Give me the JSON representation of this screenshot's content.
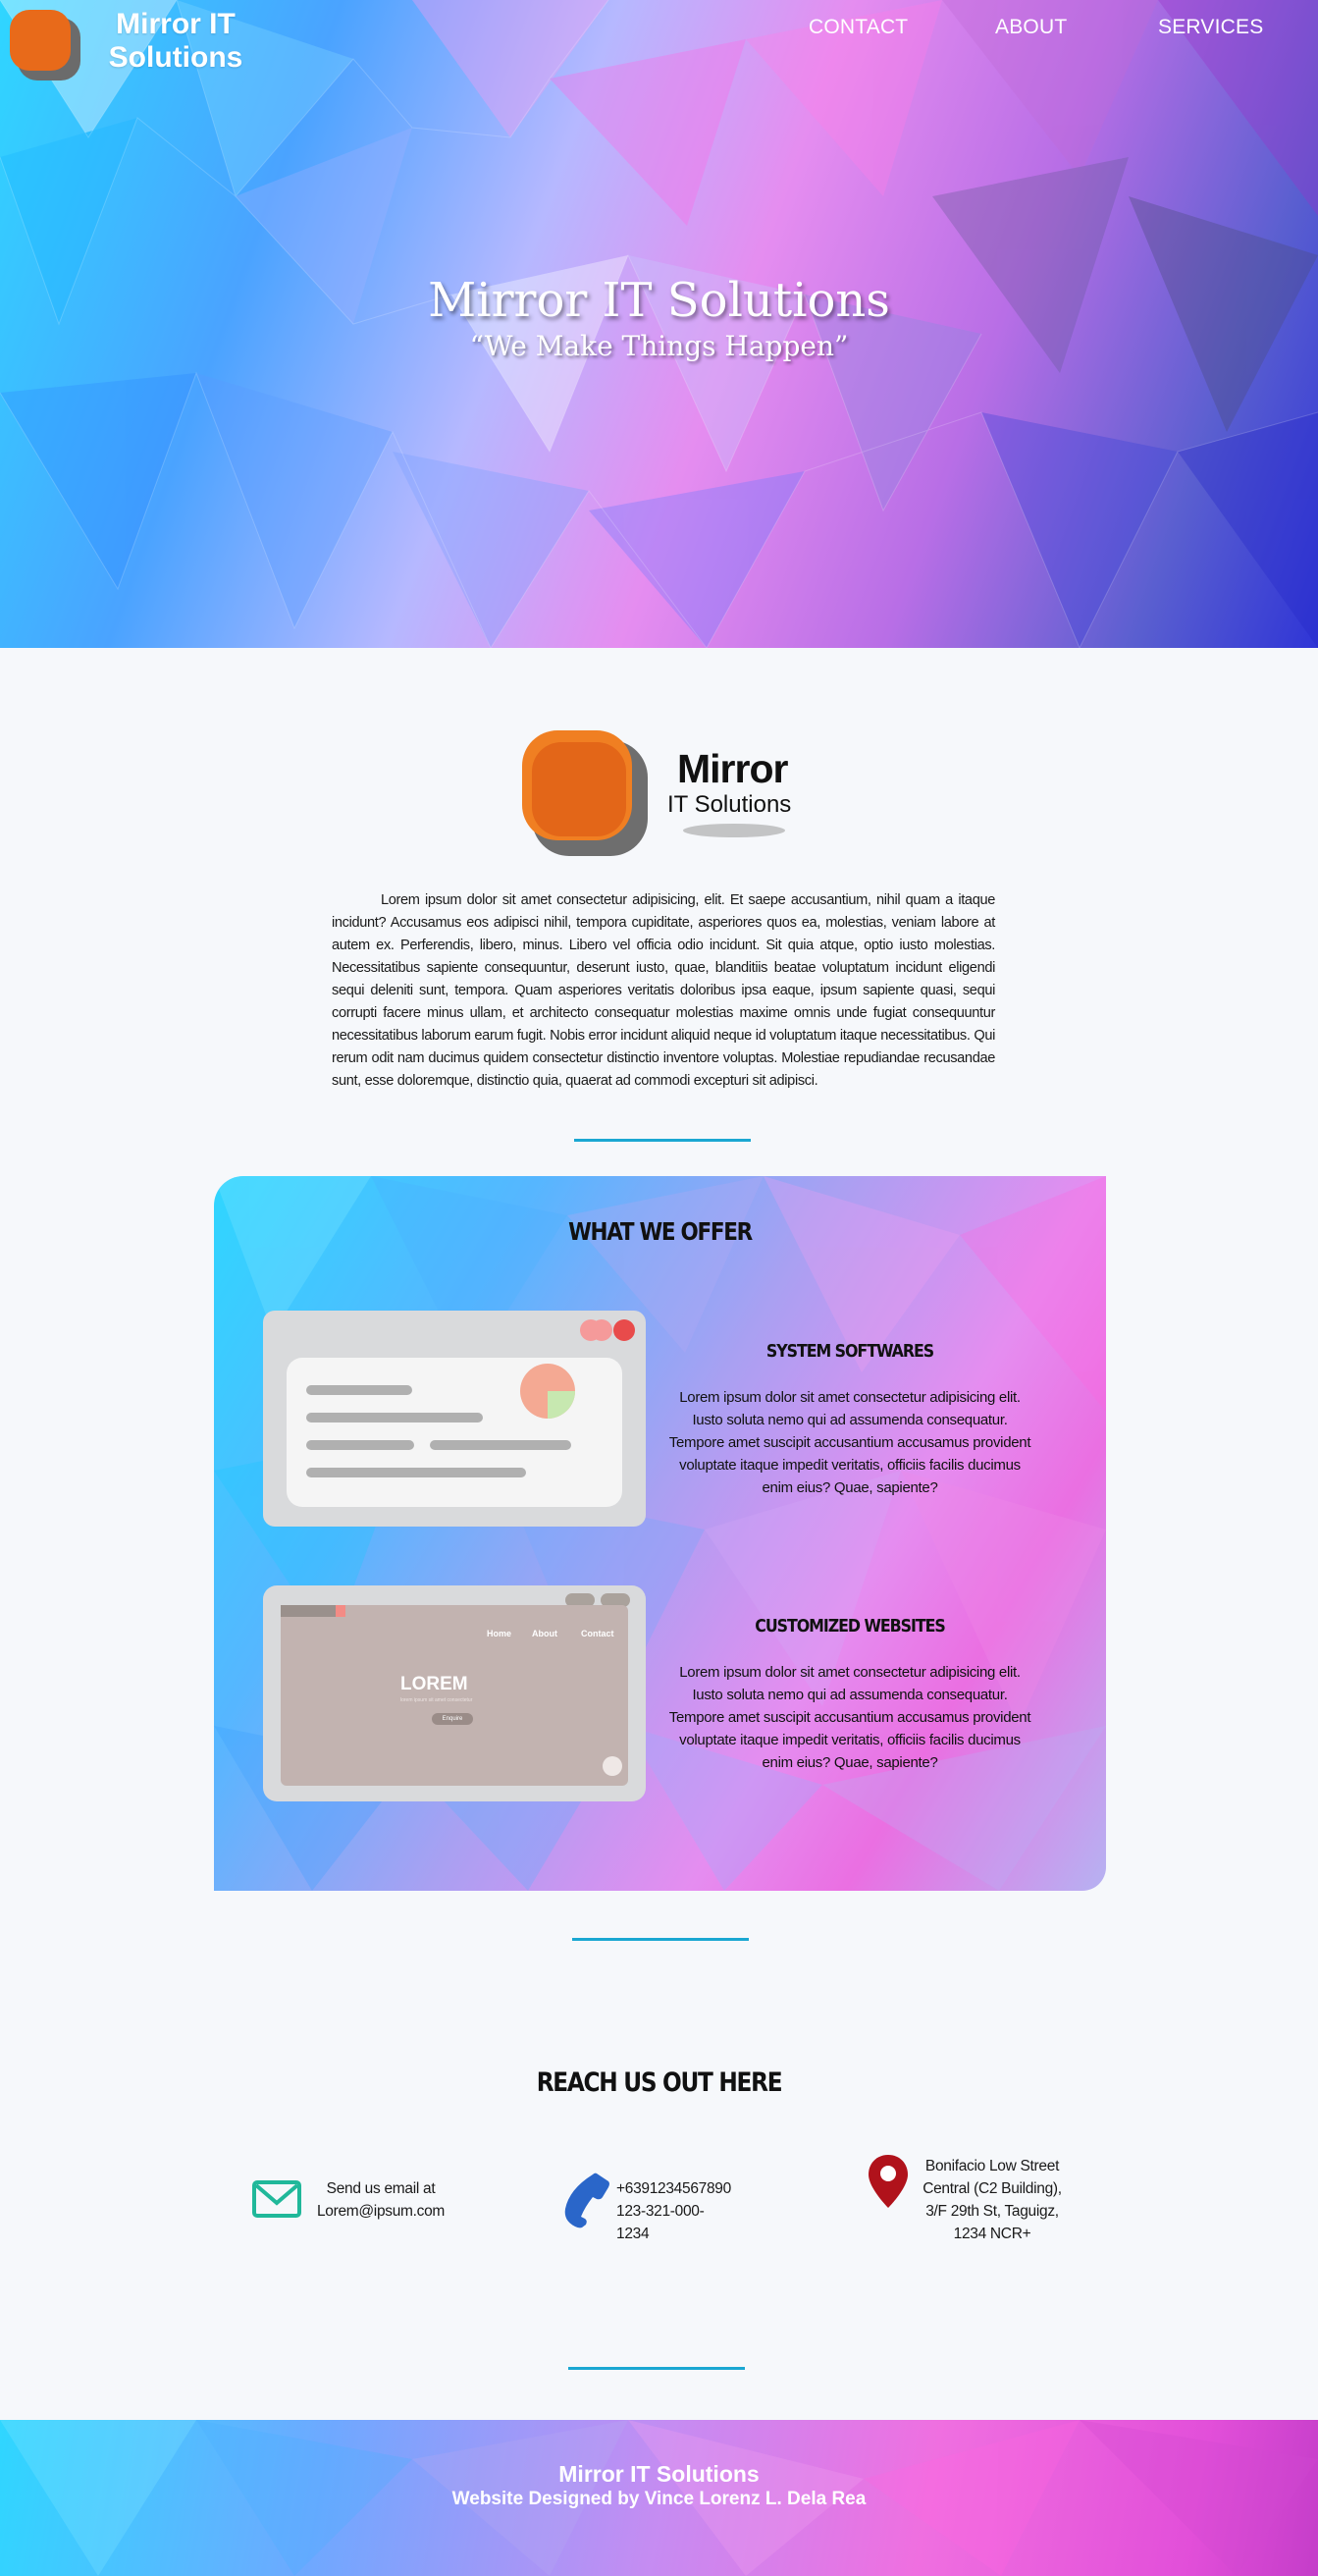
{
  "nav": {
    "brand_line1": "Mirror IT",
    "brand_line2": "Solutions",
    "links": [
      "CONTACT",
      "ABOUT",
      "SERVICES"
    ]
  },
  "hero": {
    "title": "Mirror IT Solutions",
    "tagline": "“We Make Things Happen”"
  },
  "about": {
    "logo_word1": "Mirror",
    "logo_word2": "IT Solutions",
    "text": "Lorem ipsum dolor sit amet consectetur adipisicing, elit. Et saepe accusantium, nihil quam a itaque incidunt? Accusamus eos adipisci nihil, tempora cupiditate, asperiores quos ea, molestias, veniam labore at autem ex. Perferendis, libero, minus. Libero vel officia odio incidunt. Sit quia atque, optio iusto molestias. Necessitatibus sapiente consequuntur, deserunt iusto, quae, blanditiis beatae voluptatum incidunt eligendi sequi deleniti sunt, tempora. Quam asperiores veritatis doloribus ipsa eaque, ipsum sapiente quasi, sequi corrupti facere minus ullam, et architecto consequatur molestias maxime omnis unde fugiat consequuntur necessitatibus laborum earum fugit. Nobis error incidunt aliquid neque id voluptatum itaque necessitatibus. Qui rerum odit nam ducimus quidem consectetur distinctio inventore voluptas. Molestiae repudiandae recusandae sunt, esse doloremque, distinctio quia, quaerat ad commodi excepturi sit adipisci."
  },
  "offer": {
    "title": "WHAT WE OFFER",
    "items": [
      {
        "heading": "SYSTEM SOFTWARES",
        "desc": "Lorem ipsum dolor sit amet consectetur adipisicing elit. Iusto soluta nemo qui ad assumenda consequatur. Tempore amet suscipit accusantium accusamus provident voluptate itaque impedit veritatis, officiis facilis ducimus enim eius? Quae, sapiente?"
      },
      {
        "heading": "CUSTOMIZED WEBSITES",
        "desc": "Lorem ipsum dolor sit amet consectetur adipisicing elit. Iusto soluta nemo qui ad assumenda consequatur. Tempore amet suscipit accusantium accusamus provident voluptate itaque impedit veritatis, officiis facilis ducimus enim eius? Quae, sapiente?"
      }
    ],
    "mock_site": {
      "nav": [
        "Home",
        "About",
        "Contact"
      ],
      "hero_word": "LOREM",
      "sub": "lorem ipsum sit amet consectetur",
      "button": "Enquire"
    }
  },
  "contact": {
    "title": "REACH US OUT HERE",
    "email_line1": "Send us email at",
    "email_line2": "Lorem@ipsum.com",
    "phone_line1": "+6391234567890",
    "phone_line2": "123-321-000-1234",
    "address_line1": "Bonifacio Low Street",
    "address_line2": "Central (C2 Building),",
    "address_line3": "3/F 29th St, Taguigz,",
    "address_line4": "1234 NCR+",
    "colors": {
      "email": "#20b89a",
      "phone": "#2a66c9",
      "location": "#b0121b"
    }
  },
  "footer": {
    "title": "Mirror IT Solutions",
    "credit": "Website Designed by Vince Lorenz L. Dela Rea"
  },
  "icons": [
    "app-logo-icon",
    "envelope-icon",
    "phone-icon",
    "map-pin-icon"
  ]
}
